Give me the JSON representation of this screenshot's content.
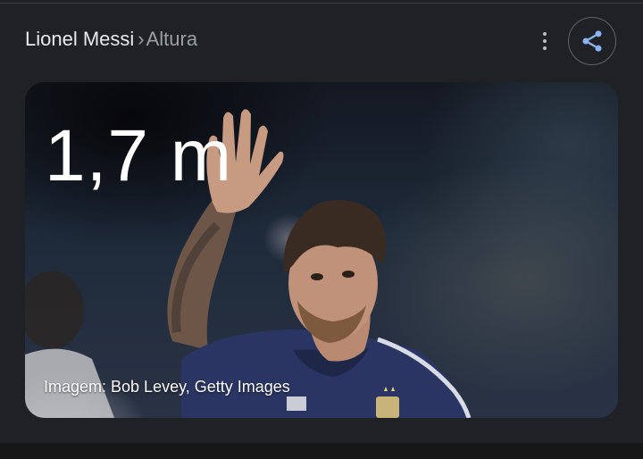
{
  "breadcrumb": {
    "entity": "Lionel Messi",
    "separator": "›",
    "attribute": "Altura"
  },
  "actions": {
    "more_icon": "more-vert-icon",
    "share_icon": "share-icon",
    "share_color": "#8ab4f8"
  },
  "card": {
    "value": "1,7 m",
    "image_credit": "Imagem: Bob Levey, Getty Images"
  },
  "colors": {
    "background": "#202124",
    "primary_text": "#e8eaed",
    "secondary_text": "#9aa0a6"
  }
}
